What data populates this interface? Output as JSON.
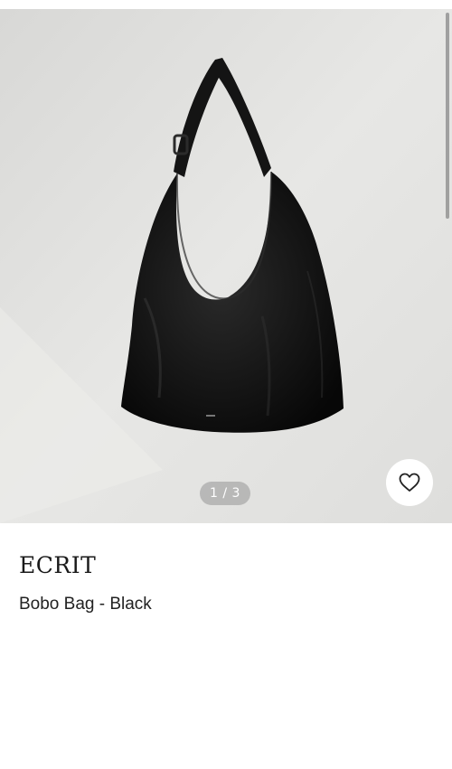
{
  "product": {
    "brand": "ECRIT",
    "name": "Bobo Bag - Black",
    "image_alt": "Black leather hobo shoulder bag"
  },
  "gallery": {
    "pager": "1 / 3",
    "current": 1,
    "total": 3
  },
  "icons": {
    "wishlist": "heart-outline-icon"
  },
  "colors": {
    "background": "#ffffff",
    "photo_background": "#e2e2e0",
    "bag": "#111111",
    "pager_bg": "#969696",
    "text": "#1a1a1a"
  }
}
